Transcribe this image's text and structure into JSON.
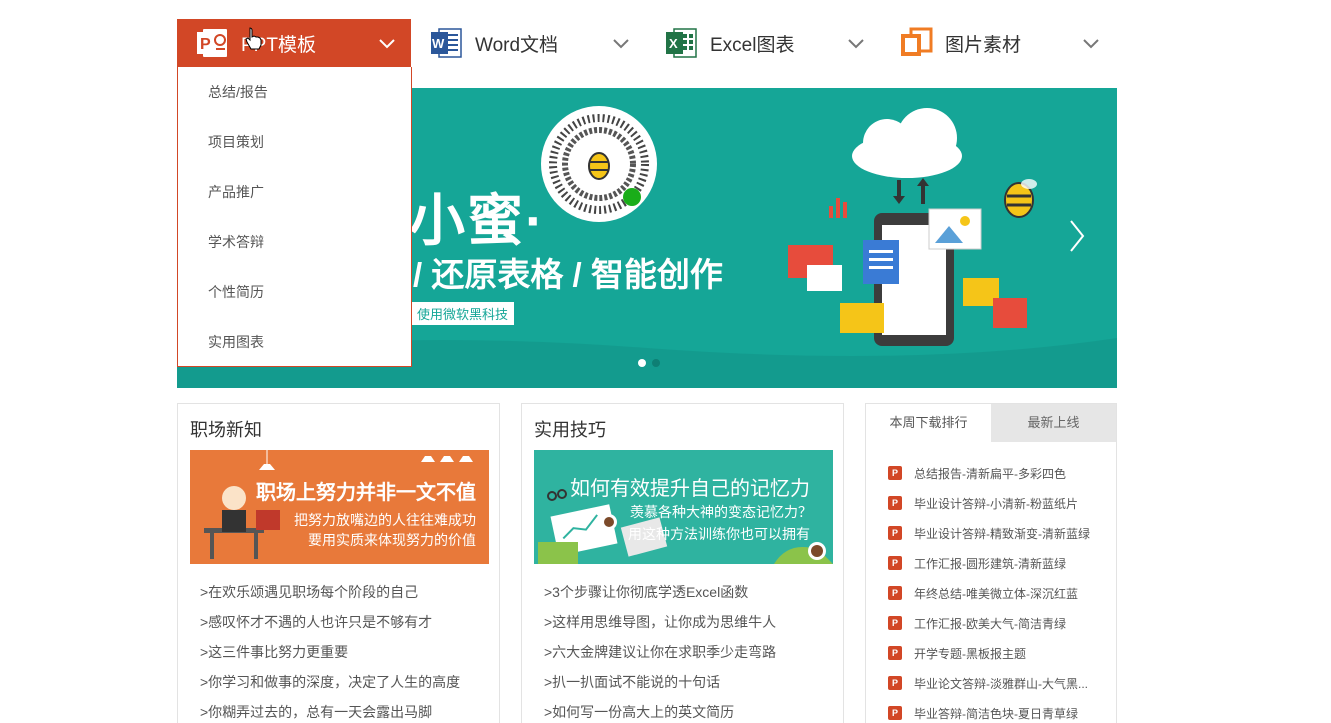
{
  "nav": {
    "items": [
      {
        "label": "PPT模板",
        "icon": "powerpoint-icon"
      },
      {
        "label": "Word文档",
        "icon": "word-icon"
      },
      {
        "label": "Excel图表",
        "icon": "excel-icon"
      },
      {
        "label": "图片素材",
        "icon": "image-icon"
      }
    ]
  },
  "dropdown": {
    "items": [
      "总结/报告",
      "项目策划",
      "产品推广",
      "学术答辩",
      "个性简历",
      "实用图表"
    ]
  },
  "banner": {
    "headline": "小蜜·",
    "subline": "/ 还原表格 / 智能创作",
    "tag": "使用微软黑科技"
  },
  "panels": {
    "career": {
      "title": "职场新知",
      "banner_title": "职场上努力并非一文不值",
      "banner_sub1": "把努力放嘴边的人往往难成功",
      "banner_sub2": "要用实质来体现努力的价值",
      "items": [
        ">在欢乐颂遇见职场每个阶段的自己",
        ">感叹怀才不遇的人也许只是不够有才",
        ">这三件事比努力更重要",
        ">你学习和做事的深度，决定了人生的高度",
        ">你糊弄过去的，总有一天会露出马脚"
      ]
    },
    "tips": {
      "title": "实用技巧",
      "banner_title": "如何有效提升自己的记忆力",
      "banner_sub1": "羡慕各种大神的变态记忆力？",
      "banner_sub2": "用这种方法训练你也可以拥有",
      "items": [
        ">3个步骤让你彻底学透Excel函数",
        ">这样用思维导图，让你成为思维牛人",
        ">六大金牌建议让你在求职季少走弯路",
        ">扒一扒面试不能说的十句话",
        ">如何写一份高大上的英文简历"
      ]
    },
    "ranking": {
      "tab_weekly": "本周下载排行",
      "tab_new": "最新上线",
      "items": [
        "总结报告-清新扁平-多彩四色",
        "毕业设计答辩-小清新-粉蓝纸片",
        "毕业设计答辩-精致渐变-清新蓝绿",
        "工作汇报-圆形建筑-清新蓝绿",
        "年终总结-唯美微立体-深沉红蓝",
        "工作汇报-欧美大气-简洁青绿",
        "开学专题-黑板报主题",
        "毕业论文答辩-淡雅群山-大气黑...",
        "毕业答辩-简洁色块-夏日青草绿"
      ]
    }
  },
  "colors": {
    "ppt": "#d24726",
    "word": "#2b579a",
    "excel": "#217346",
    "image": "#f07c24",
    "banner": "#15a697",
    "career_banner": "#e8793a",
    "tips_banner": "#2fb3a0"
  }
}
